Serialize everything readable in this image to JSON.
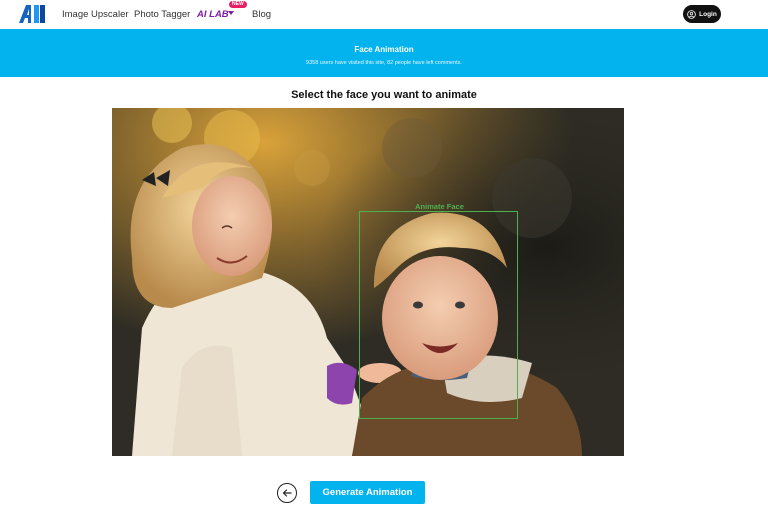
{
  "nav": {
    "logo_text": "AI",
    "links": [
      "Image Upscaler",
      "Photo Tagger",
      "Blog"
    ],
    "ai_lab_label": "AI LAB",
    "new_badge": "NEW",
    "login_label": "Login"
  },
  "banner": {
    "title": "Face Animation",
    "subtitle": "9358 users have visited this site, 82 people have left comments."
  },
  "main": {
    "heading": "Select the face you want to animate",
    "face_label": "Animate Face"
  },
  "actions": {
    "generate_label": "Generate Animation"
  },
  "icons": {
    "user": "user-circle-icon",
    "back": "arrow-left-circle-icon",
    "dropdown": "chevron-down-icon"
  },
  "colors": {
    "accent": "#03b3ee",
    "ai_lab": "#7b1fa2",
    "new_badge": "#e91e63",
    "face_box": "#4caf50"
  }
}
